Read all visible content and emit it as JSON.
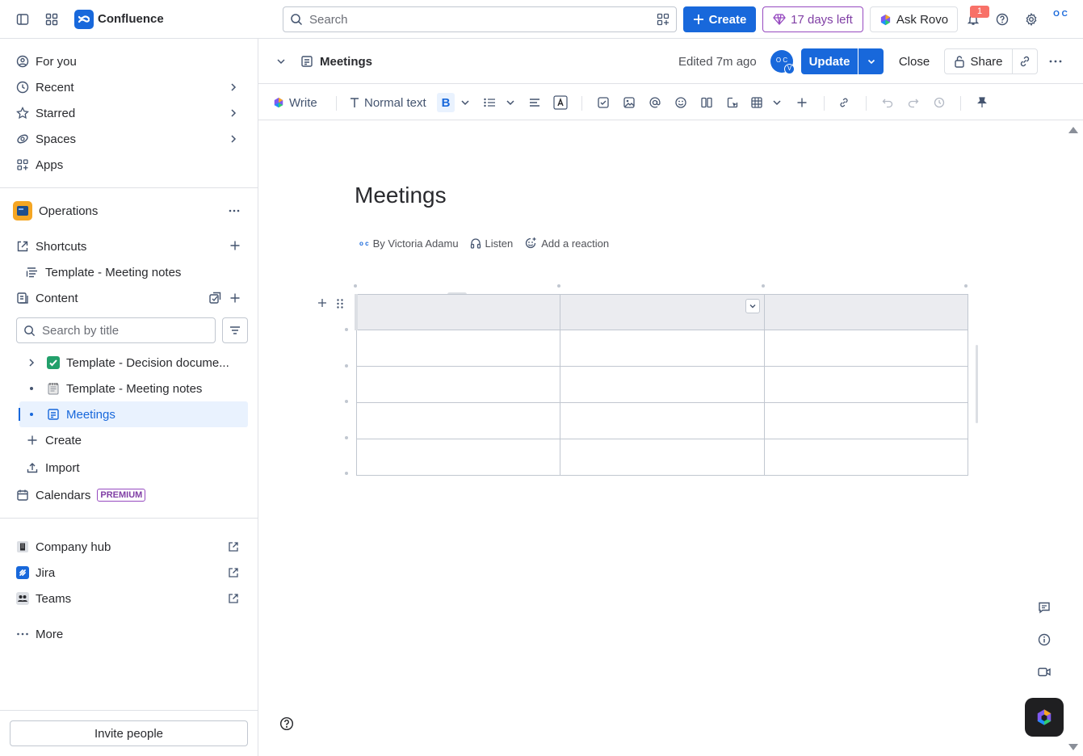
{
  "app": {
    "title": "Confluence"
  },
  "topbar": {
    "search_placeholder": "Search",
    "create_label": "Create",
    "trial_label": "17 days left",
    "ask_rovo_label": "Ask Rovo",
    "notification_count": "1",
    "avatar_initials": "O C"
  },
  "sidebar": {
    "nav": [
      {
        "label": "For you",
        "icon": "person-circle-icon"
      },
      {
        "label": "Recent",
        "icon": "clock-icon"
      },
      {
        "label": "Starred",
        "icon": "star-icon"
      },
      {
        "label": "Spaces",
        "icon": "spaces-icon"
      },
      {
        "label": "Apps",
        "icon": "apps-icon"
      }
    ],
    "space_name": "Operations",
    "shortcuts_label": "Shortcuts",
    "shortcut_item": "Template - Meeting notes",
    "content_label": "Content",
    "search_placeholder": "Search by title",
    "tree": [
      {
        "label": "Template - Decision docume...",
        "icon": "✅"
      },
      {
        "label": "Template - Meeting notes",
        "icon": "🗒️"
      },
      {
        "label": "Meetings",
        "icon": "page-icon",
        "selected": true
      }
    ],
    "create_label": "Create",
    "import_label": "Import",
    "calendars_label": "Calendars",
    "premium_label": "PREMIUM",
    "apps": [
      {
        "label": "Company hub"
      },
      {
        "label": "Jira"
      },
      {
        "label": "Teams"
      }
    ],
    "more_label": "More",
    "invite_label": "Invite people"
  },
  "page_header": {
    "title": "Meetings",
    "edited": "Edited 7m ago",
    "avatar_initials": "O C",
    "avatar_badge": "V",
    "update_label": "Update",
    "close_label": "Close",
    "share_label": "Share"
  },
  "toolbar": {
    "write_label": "Write",
    "text_style": "Normal text",
    "bold_label": "B"
  },
  "editor": {
    "title": "Meetings",
    "author": "By Victoria Adamu",
    "listen_label": "Listen",
    "reaction_label": "Add a reaction",
    "table": {
      "columns": 3,
      "rows": 5
    }
  },
  "colors": {
    "brand": "#1868db",
    "trial": "#964ac0",
    "selected_bg": "#e9f2fe",
    "table_header_bg": "#ebecf0"
  }
}
